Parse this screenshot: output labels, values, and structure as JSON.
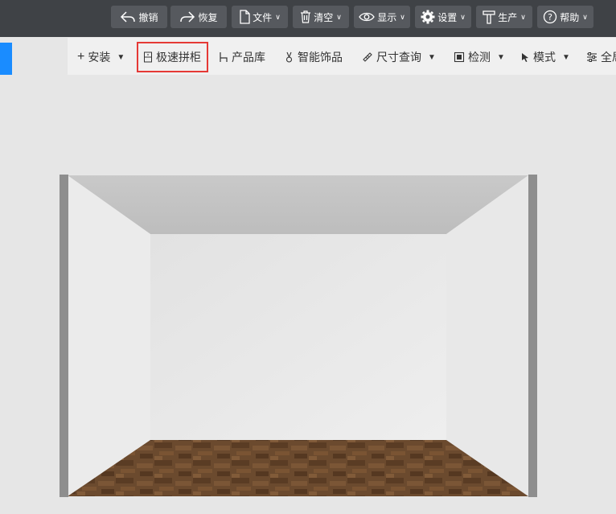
{
  "toolbar": {
    "buttons": [
      {
        "label": "撤销",
        "icon": "undo-icon"
      },
      {
        "label": "恢复",
        "icon": "redo-icon"
      },
      {
        "label": "文件",
        "icon": "file-icon",
        "dropdown": true
      },
      {
        "label": "清空",
        "icon": "trash-icon",
        "dropdown": true
      },
      {
        "label": "显示",
        "icon": "eye-icon",
        "dropdown": true
      },
      {
        "label": "设置",
        "icon": "gear-icon",
        "dropdown": true
      },
      {
        "label": "生产",
        "icon": "hammer-icon",
        "dropdown": true
      },
      {
        "label": "帮助",
        "icon": "help-icon",
        "dropdown": true
      }
    ]
  },
  "subbar": {
    "items": [
      {
        "label": "安装",
        "icon": "plus-icon",
        "dropdown": true
      },
      {
        "label": "极速拼柜",
        "icon": "cabinet-icon",
        "dropdown": false,
        "highlighted": true
      },
      {
        "label": "产品库",
        "icon": "chair-icon",
        "dropdown": false
      },
      {
        "label": "智能饰品",
        "icon": "ornament-icon",
        "dropdown": false
      },
      {
        "label": "尺寸查询",
        "icon": "ruler-icon",
        "dropdown": true
      },
      {
        "label": "检测",
        "icon": "detect-icon",
        "dropdown": true
      },
      {
        "label": "模式",
        "icon": "cursor-icon",
        "dropdown": true
      },
      {
        "label": "全局",
        "icon": "sliders-icon",
        "dropdown": false
      }
    ]
  },
  "colors": {
    "topbar_bg": "#3f4246",
    "button_bg": "#56595e",
    "accent_blue": "#1a8cff",
    "highlight_red": "#e53935",
    "floor_wood": "#6b4a2e"
  }
}
